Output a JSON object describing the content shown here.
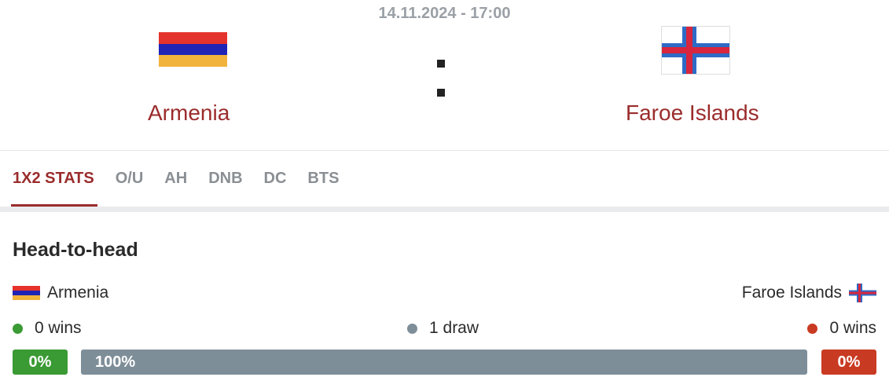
{
  "match": {
    "datetime": "14.11.2024 - 17:00",
    "home_team": "Armenia",
    "away_team": "Faroe Islands"
  },
  "tabs": [
    {
      "label": "1X2 STATS",
      "active": true
    },
    {
      "label": "O/U",
      "active": false
    },
    {
      "label": "AH",
      "active": false
    },
    {
      "label": "DNB",
      "active": false
    },
    {
      "label": "DC",
      "active": false
    },
    {
      "label": "BTS",
      "active": false
    }
  ],
  "h2h": {
    "title": "Head-to-head",
    "home_team": "Armenia",
    "away_team": "Faroe Islands",
    "home_wins_text": "0 wins",
    "draws_text": "1 draw",
    "away_wins_text": "0 wins",
    "home_pct": "0%",
    "draw_pct": "100%",
    "away_pct": "0%"
  },
  "colors": {
    "accent": "#9b2c2c",
    "home_win": "#3a9a34",
    "draw": "#7e8e99",
    "away_win": "#c93a22",
    "armenia_red": "#e4332c",
    "armenia_blue": "#1f24b5",
    "armenia_orange": "#f2b33d",
    "faroe_blue": "#2d6bc6",
    "faroe_red": "#d7263d"
  },
  "icons": {
    "home_flag": "armenia-flag-icon",
    "away_flag": "faroe-islands-flag-icon"
  }
}
